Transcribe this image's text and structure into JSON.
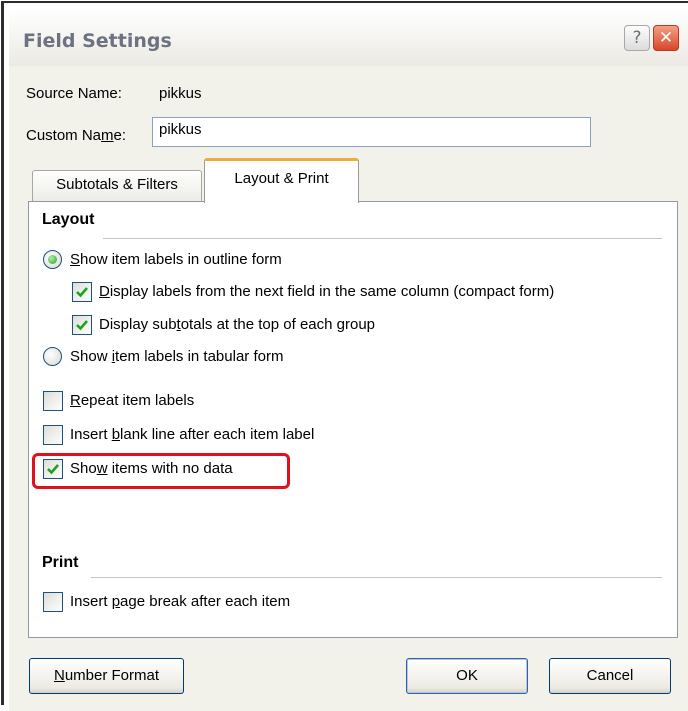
{
  "dialog": {
    "title": "Field Settings"
  },
  "titlebar": {
    "help_glyph": "?",
    "close_glyph": "✕"
  },
  "source": {
    "label": "Source Name:",
    "value": "pikkus"
  },
  "custom": {
    "label_pre": "Custom Na",
    "label_key": "m",
    "label_post": "e:",
    "value": "pikkus"
  },
  "tabs": [
    {
      "label": "Subtotals & Filters",
      "active": false
    },
    {
      "label": "Layout & Print",
      "active": true
    }
  ],
  "layout": {
    "title": "Layout",
    "outline": {
      "key": "S",
      "rest": "how item labels in outline form",
      "selected": true
    },
    "compact": {
      "key": "D",
      "rest": "isplay labels from the next field in the same column (compact form)",
      "checked": true
    },
    "subtotals_top": {
      "pre": "Display sub",
      "key": "t",
      "post": "otals at the top of each group",
      "checked": true
    },
    "tabular": {
      "pre": "Show ",
      "key": "i",
      "post": "tem labels in tabular form",
      "selected": false
    },
    "repeat": {
      "key": "R",
      "rest": "epeat item labels",
      "checked": false
    },
    "blank_line": {
      "pre": "Insert ",
      "key": "b",
      "post": "lank line after each item label",
      "checked": false
    },
    "no_data": {
      "pre": "Sho",
      "key": "w",
      "post": " items with no data",
      "checked": true
    }
  },
  "print": {
    "title": "Print",
    "page_break": {
      "pre": "Insert ",
      "key": "p",
      "post": "age break after each item",
      "checked": false
    }
  },
  "buttons": {
    "number_format": {
      "key": "N",
      "rest": "umber Format"
    },
    "ok": "OK",
    "cancel": "Cancel"
  },
  "colors": {
    "highlight": "#e0101c",
    "tab_accent": "#f0a93c",
    "check_mark": "#21a121"
  },
  "icons": {
    "check": "check-icon",
    "close": "close-icon",
    "help": "help-icon"
  }
}
